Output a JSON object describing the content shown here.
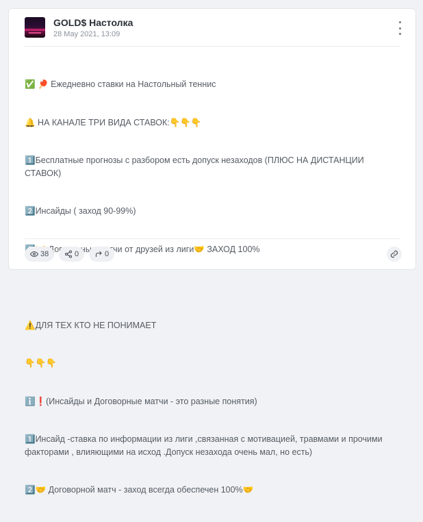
{
  "channel": {
    "name": "GOLD$ Настолка",
    "date": "28 May 2021, 13:09"
  },
  "post": {
    "lines": [
      "✅ 🏓 Ежедневно ставки на Настольный теннис",
      "🔔 НА КАНАЛЕ ТРИ ВИДА СТАВОК:👇👇👇",
      "1️⃣Бесплатные прогнозы с разбором есть допуск незаходов (ПЛЮС НА ДИСТАНЦИИ СТАВОК)",
      "2️⃣Инсайды ( заход 90-99%)",
      "3️⃣🤝 Договорные матчи от друзей из лиги🤝 ЗАХОД 100%",
      "",
      "⚠️ДЛЯ ТЕХ КТО НЕ ПОНИМАЕТ",
      "👇👇👇",
      "ℹ️❗(Инсайды и Договорные матчи - это разные понятия)",
      "1️⃣Инсайд -ставка по информации из лиги ,связанная с мотивацией, травмами и прочими факторами , влияющими на исход .Допуск незахода очень мал, но есть)",
      "2️⃣🤝 Договорной матч - заход всегда обеспечен 100%🤝"
    ]
  },
  "footer": {
    "views": "38",
    "shares": "0",
    "forwards": "0"
  },
  "icons": {
    "views": "eye-icon",
    "shares": "share-icon",
    "forwards": "forward-arrow-icon",
    "link": "link-icon",
    "menu": "kebab-menu-icon"
  }
}
